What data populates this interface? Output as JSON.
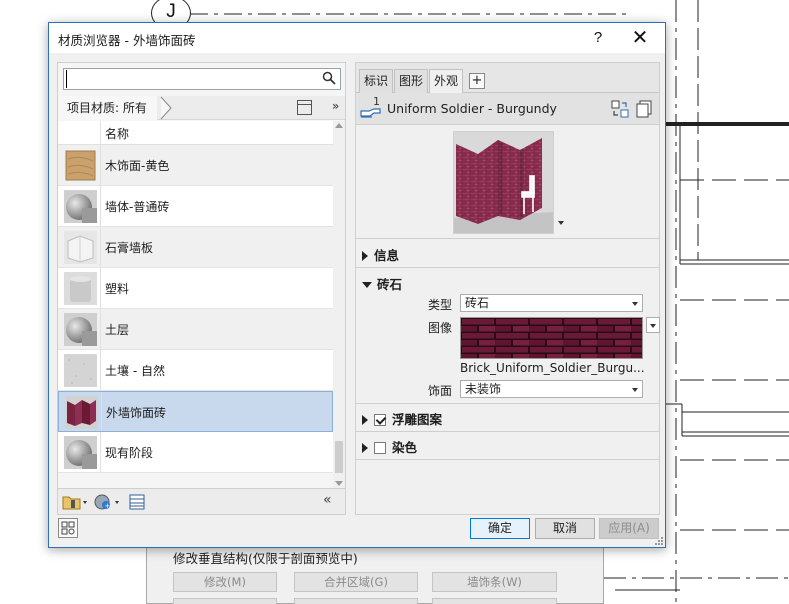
{
  "background": {
    "grid_bubble": "J",
    "panel_title": "修改垂直结构(仅限于剖面预览中)",
    "buttons": [
      "修改(M)",
      "合并区域(G)",
      "墙饰条(W)"
    ]
  },
  "dialog": {
    "title": "材质浏览器 - 外墙饰面砖",
    "help": "?",
    "close": "✕"
  },
  "left": {
    "search": {
      "value": "",
      "placeholder": ""
    },
    "filter": "项目材质: 所有",
    "column_header": "名称",
    "materials": [
      {
        "name": "木饰面-黄色",
        "thumb": "wood-cube",
        "selected": false
      },
      {
        "name": "墙体-普通砖",
        "thumb": "gray-sphere",
        "selected": false
      },
      {
        "name": "石膏墙板",
        "thumb": "light-cube",
        "selected": false
      },
      {
        "name": "塑料",
        "thumb": "cylinder",
        "selected": false
      },
      {
        "name": "土层",
        "thumb": "gray-sphere",
        "selected": false
      },
      {
        "name": "土壤 - 自然",
        "thumb": "noise",
        "selected": false
      },
      {
        "name": "外墙饰面砖",
        "thumb": "brick-wall",
        "selected": true
      },
      {
        "name": "现有阶段",
        "thumb": "gray-sphere",
        "selected": false
      }
    ],
    "toolbar_collapse": "«"
  },
  "right": {
    "tabs": [
      "标识",
      "图形",
      "外观"
    ],
    "active_tab": "外观",
    "add_tab": "+",
    "asset_count": "1",
    "asset_name": "Uniform Soldier - Burgundy",
    "sections": {
      "info": "信息",
      "masonry": "砖石",
      "relief": "浮雕图案",
      "tint": "染色"
    },
    "props": {
      "type_label": "类型",
      "type_value": "砖石",
      "image_label": "图像",
      "image_name": "Brick_Uniform_Soldier_Burgu...",
      "finish_label": "饰面",
      "finish_value": "未装饰"
    },
    "relief_checked": true,
    "tint_checked": false
  },
  "buttons": {
    "ok": "确定",
    "cancel": "取消",
    "apply": "应用(A)"
  },
  "colors": {
    "selection": "#c8d9ee",
    "brick": "#6b1a36",
    "accent": "#0078d7"
  }
}
